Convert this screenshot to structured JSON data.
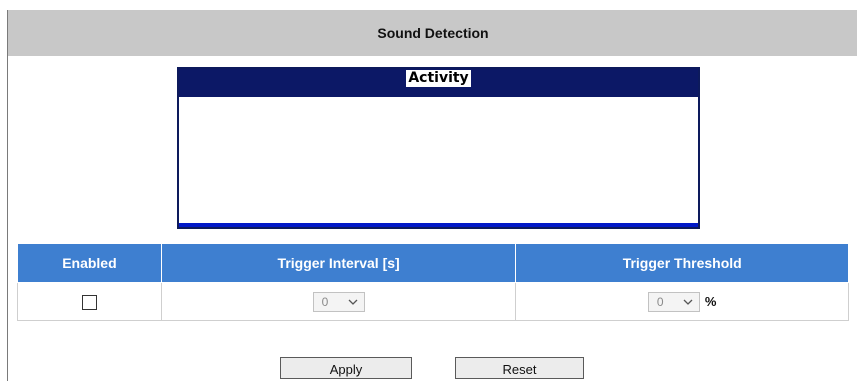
{
  "header": {
    "title": "Sound Detection"
  },
  "activity": {
    "title": "Activity"
  },
  "table": {
    "columns": [
      "Enabled",
      "Trigger Interval [s]",
      "Trigger Threshold"
    ],
    "row": {
      "enabled": false,
      "trigger_interval": "0",
      "trigger_threshold": "0",
      "threshold_unit": "%"
    }
  },
  "buttons": {
    "apply": "Apply",
    "reset": "Reset"
  },
  "icons": {
    "select_arrow": "chevron-down-icon",
    "checkbox": "checkbox-unchecked"
  },
  "colors": {
    "header_bar": "#c8c8c8",
    "activity_header": "#0c1866",
    "activity_bottom_line": "#0018c8",
    "table_header": "#3e7fd0"
  }
}
